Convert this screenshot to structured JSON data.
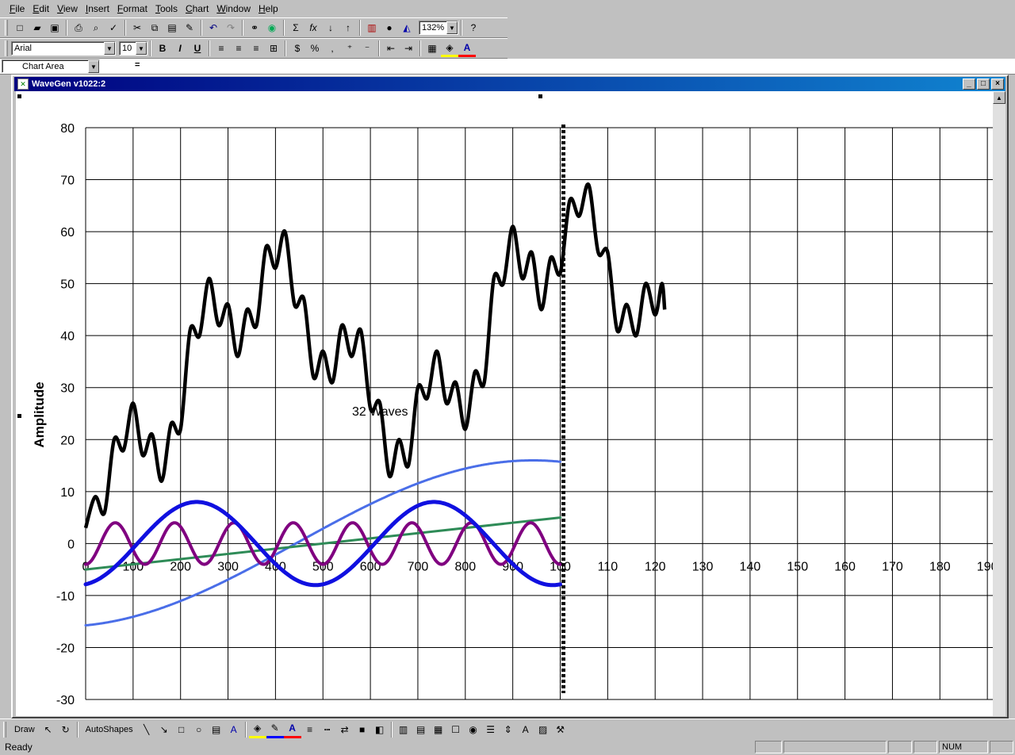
{
  "menu": [
    "File",
    "Edit",
    "View",
    "Insert",
    "Format",
    "Tools",
    "Chart",
    "Window",
    "Help"
  ],
  "toolbar": {
    "zoom": "132%",
    "font_name": "Arial",
    "font_size": "10",
    "bold": "B",
    "italic": "I",
    "underline": "U"
  },
  "formula": {
    "name_box": "Chart Area",
    "equals": "="
  },
  "window": {
    "title": "WaveGen v1022:2"
  },
  "drawbar": {
    "draw_label": "Draw",
    "autoshapes_label": "AutoShapes"
  },
  "status": {
    "text": "Ready",
    "num": "NUM"
  },
  "chart_data": {
    "type": "line",
    "ylabel": "Amplitude",
    "annotation": "32 Waves",
    "ylim": [
      -30,
      80
    ],
    "yticks": [
      80,
      70,
      60,
      50,
      40,
      30,
      20,
      10,
      0,
      -10,
      -20,
      -30
    ],
    "xticks": [
      "0",
      "100",
      "200",
      "300",
      "400",
      "500",
      "600",
      "700",
      "800",
      "900",
      "100",
      "110",
      "120",
      "130",
      "140",
      "150",
      "160",
      "170",
      "180",
      "190"
    ],
    "grid": true,
    "colors": {
      "sum": "#000000",
      "blue": "#1010e0",
      "lightblue": "#4a6ee8",
      "purple": "#800080",
      "green": "#2e8b57",
      "marker": "#000000"
    },
    "series": [
      {
        "key": "sum",
        "points": [
          [
            0,
            3
          ],
          [
            10,
            9
          ],
          [
            20,
            6
          ],
          [
            30,
            20
          ],
          [
            40,
            18
          ],
          [
            50,
            27
          ],
          [
            60,
            17
          ],
          [
            70,
            21
          ],
          [
            80,
            12
          ],
          [
            90,
            23
          ],
          [
            100,
            22
          ],
          [
            110,
            41
          ],
          [
            120,
            40
          ],
          [
            130,
            51
          ],
          [
            140,
            42
          ],
          [
            150,
            46
          ],
          [
            160,
            36
          ],
          [
            170,
            45
          ],
          [
            180,
            42
          ],
          [
            190,
            57
          ],
          [
            200,
            53
          ],
          [
            210,
            60
          ],
          [
            220,
            46
          ],
          [
            230,
            47
          ],
          [
            240,
            32
          ],
          [
            250,
            37
          ],
          [
            260,
            31
          ],
          [
            270,
            42
          ],
          [
            280,
            36
          ],
          [
            290,
            41
          ],
          [
            300,
            26
          ],
          [
            310,
            27
          ],
          [
            320,
            13
          ],
          [
            330,
            20
          ],
          [
            340,
            15
          ],
          [
            350,
            30
          ],
          [
            360,
            28
          ],
          [
            370,
            37
          ],
          [
            380,
            27
          ],
          [
            390,
            31
          ],
          [
            400,
            22
          ],
          [
            410,
            33
          ],
          [
            420,
            31
          ],
          [
            430,
            51
          ],
          [
            440,
            50
          ],
          [
            450,
            61
          ],
          [
            460,
            51
          ],
          [
            470,
            56
          ],
          [
            480,
            45
          ],
          [
            490,
            55
          ],
          [
            500,
            52
          ],
          [
            510,
            66
          ],
          [
            520,
            63
          ],
          [
            530,
            69
          ],
          [
            540,
            56
          ],
          [
            550,
            56
          ],
          [
            560,
            41
          ],
          [
            570,
            46
          ],
          [
            580,
            40
          ],
          [
            590,
            50
          ],
          [
            600,
            44
          ],
          [
            607,
            50
          ],
          [
            610,
            45
          ]
        ]
      },
      {
        "key": "blue",
        "period": 250,
        "amplitude": 8,
        "range": [
          0,
          500
        ]
      },
      {
        "key": "lightblue",
        "period": 1000,
        "amplitude": 16,
        "range": [
          0,
          500
        ]
      },
      {
        "key": "purple",
        "period": 62.5,
        "amplitude": 4,
        "range": [
          0,
          500
        ]
      },
      {
        "key": "green",
        "from": [
          0,
          -5
        ],
        "to": [
          500,
          5
        ]
      }
    ],
    "marker_x": 500
  }
}
